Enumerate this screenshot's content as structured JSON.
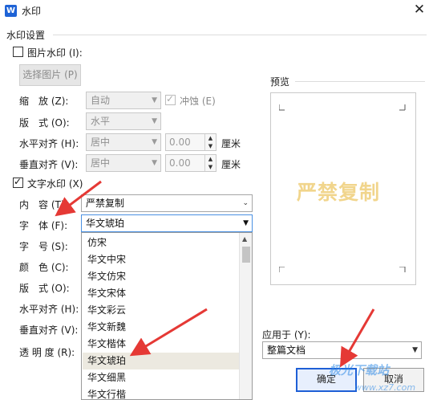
{
  "window": {
    "title": "水印",
    "app_icon": "W"
  },
  "group": {
    "label": "水印设置"
  },
  "picture": {
    "checkbox_label": "图片水印 (I):",
    "select_button": "选择图片 (P)",
    "scale_label": "缩　放 (Z):",
    "scale_value": "自动",
    "washout_label": "冲蚀 (E)",
    "layout_label": "版　式 (O):",
    "layout_value": "水平",
    "halign_label": "水平对齐 (H):",
    "halign_value": "居中",
    "halign_offset": "0.00",
    "valign_label": "垂直对齐 (V):",
    "valign_value": "居中",
    "valign_offset": "0.00",
    "unit": "厘米"
  },
  "text": {
    "checkbox_label": "文字水印 (X)",
    "content_label": "内　容 (T):",
    "content_value": "严禁复制",
    "font_label": "字　体 (F):",
    "font_value": "华文琥珀",
    "size_label": "字　号 (S):",
    "color_label": "颜　色 (C):",
    "layout_label": "版　式 (O):",
    "halign_label": "水平对齐 (H):",
    "valign_label": "垂直对齐 (V):",
    "transparency_label": "透 明 度 (R):"
  },
  "font_dropdown": {
    "options": [
      "仿宋",
      "华文中宋",
      "华文仿宋",
      "华文宋体",
      "华文彩云",
      "华文新魏",
      "华文楷体",
      "华文琥珀",
      "华文细黑",
      "华文行楷"
    ],
    "selected": "华文琥珀"
  },
  "preview": {
    "label": "预览",
    "watermark_text": "严禁复制"
  },
  "apply": {
    "label": "应用于 (Y):",
    "value": "整篇文档"
  },
  "buttons": {
    "ok": "确定",
    "cancel": "取消"
  },
  "overlay": {
    "logo_text": "极光下载站",
    "logo_url": "www.xz7.com"
  },
  "colors": {
    "accent": "#1e5fd6",
    "arrow": "#e53935",
    "watermark": "#e8bc46"
  }
}
